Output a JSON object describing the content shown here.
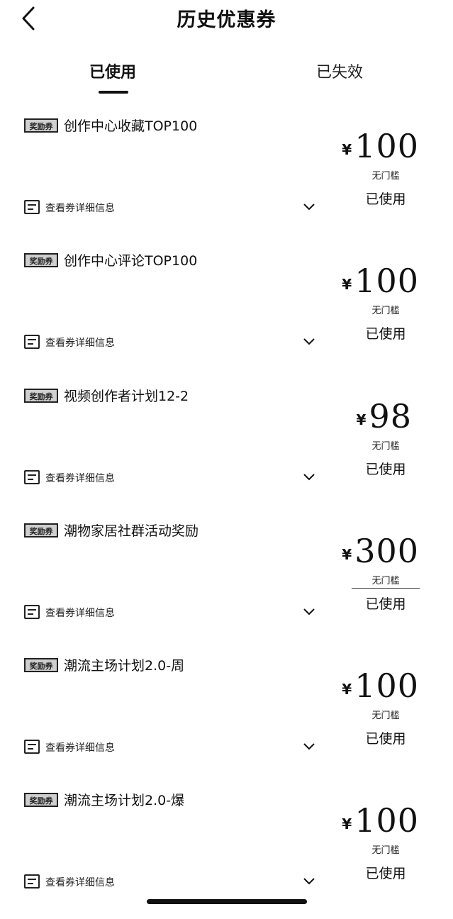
{
  "nav": {
    "back_icon": "chevron-left-icon",
    "title": "历史优惠券"
  },
  "tabs": [
    {
      "label": "已使用",
      "active": true
    },
    {
      "label": "已失效",
      "active": false
    }
  ],
  "coupons": [
    {
      "tag": "奖励券",
      "title": "创作中心收藏TOP100",
      "detail": "查看券详细信息",
      "currency": "¥",
      "amount": "100",
      "threshold": "无门槛",
      "status": "已使用"
    },
    {
      "tag": "奖励券",
      "title": "创作中心评论TOP100",
      "detail": "查看券详细信息",
      "currency": "¥",
      "amount": "100",
      "threshold": "无门槛",
      "status": "已使用"
    },
    {
      "tag": "奖励券",
      "title": "视频创作者计划12-2",
      "detail": "查看券详细信息",
      "currency": "¥",
      "amount": "98",
      "threshold": "无门槛",
      "status": "已使用"
    },
    {
      "tag": "奖励券",
      "title": "潮物家居社群活动奖励",
      "detail": "查看券详细信息",
      "currency": "¥",
      "amount": "300",
      "threshold": "无门槛",
      "status": "已使用"
    },
    {
      "tag": "奖励券",
      "title": "潮流主场计划2.0-周",
      "detail": "查看券详细信息",
      "currency": "¥",
      "amount": "100",
      "threshold": "无门槛",
      "status": "已使用"
    },
    {
      "tag": "奖励券",
      "title": "潮流主场计划2.0-爆",
      "detail": "查看券详细信息",
      "currency": "¥",
      "amount": "100",
      "threshold": "无门槛",
      "status": "已使用"
    }
  ],
  "colors": {
    "text": "#111111",
    "background": "#ffffff",
    "tag_fill": "#cfcfcf"
  }
}
